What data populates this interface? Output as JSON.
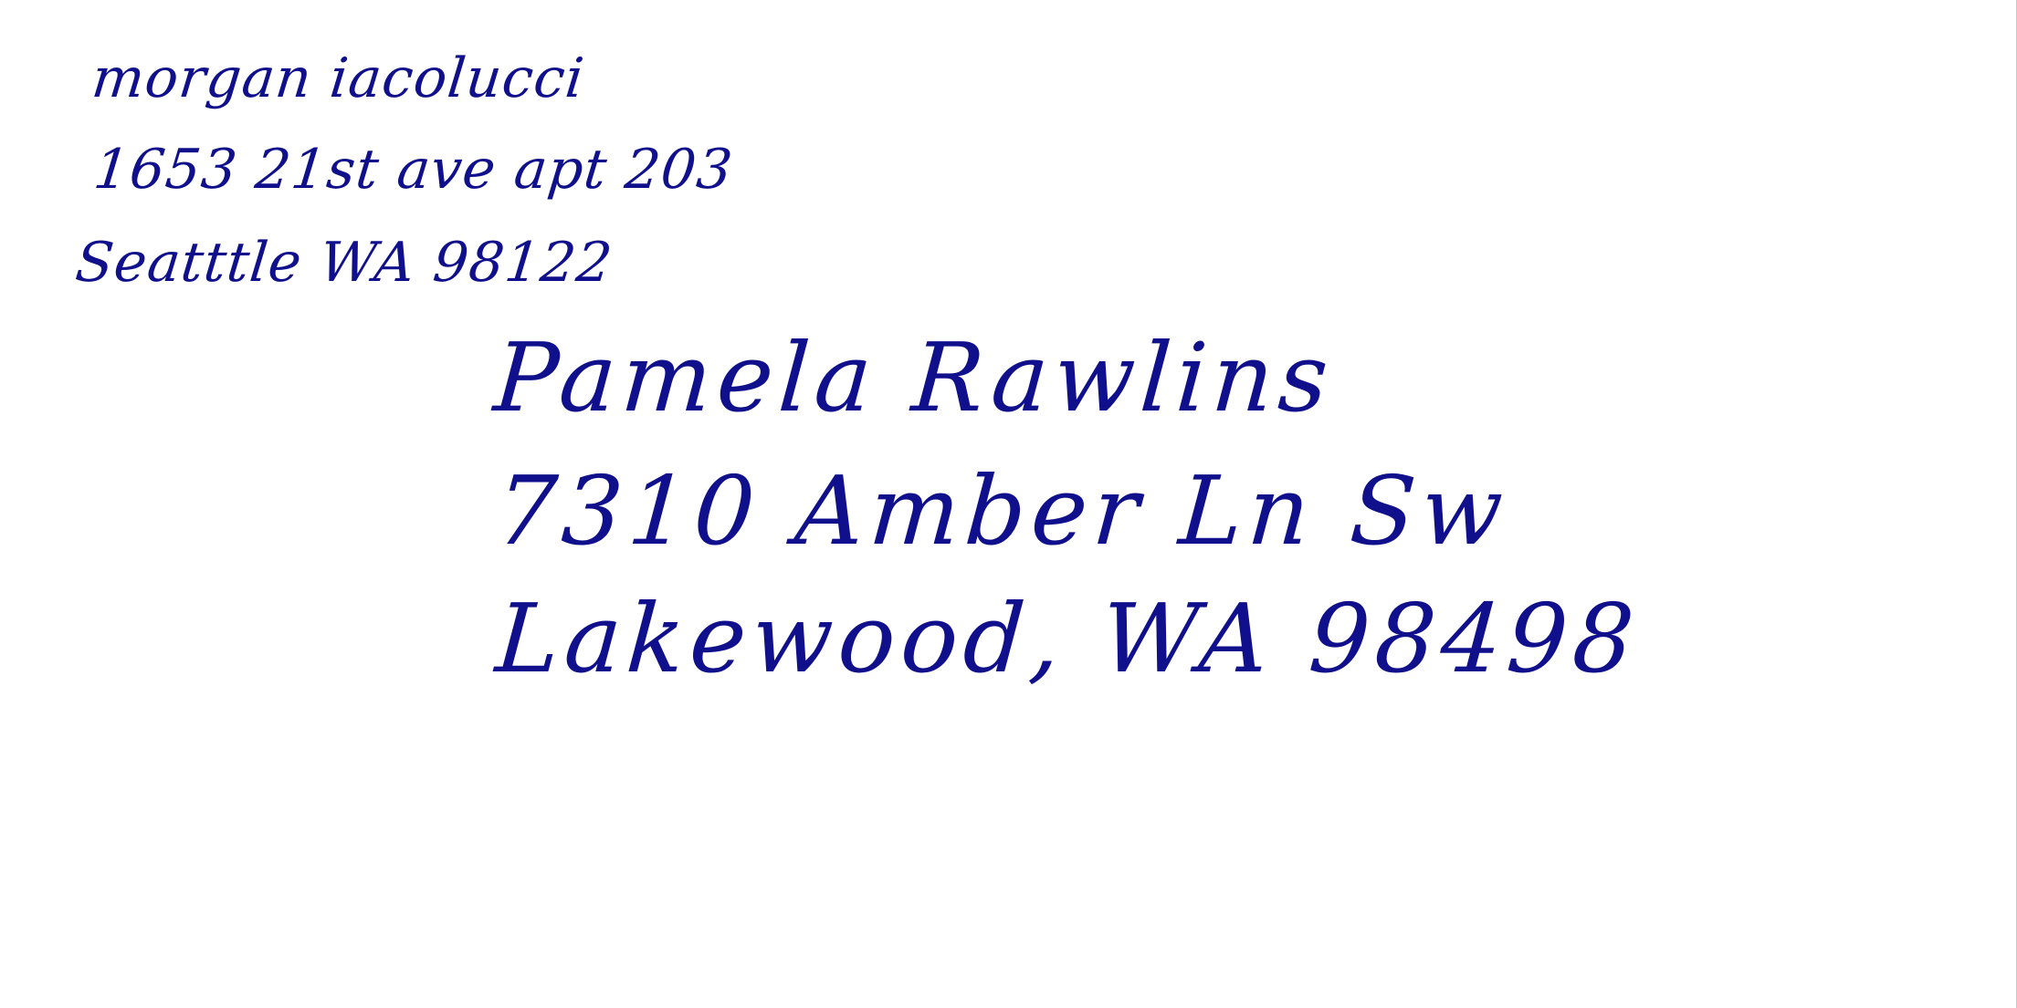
{
  "envelope": {
    "ink_color": "#10108c",
    "paper_color": "#ffffff",
    "return_address": {
      "name": "morgan iacolucci",
      "street": "1653 21st ave apt 203",
      "city_state_zip": "Seatttle WA 98122"
    },
    "recipient": {
      "name": "Pamela Rawlins",
      "street": "7310 Amber Ln Sw",
      "city_state_zip": "Lakewood, WA 98498"
    }
  }
}
